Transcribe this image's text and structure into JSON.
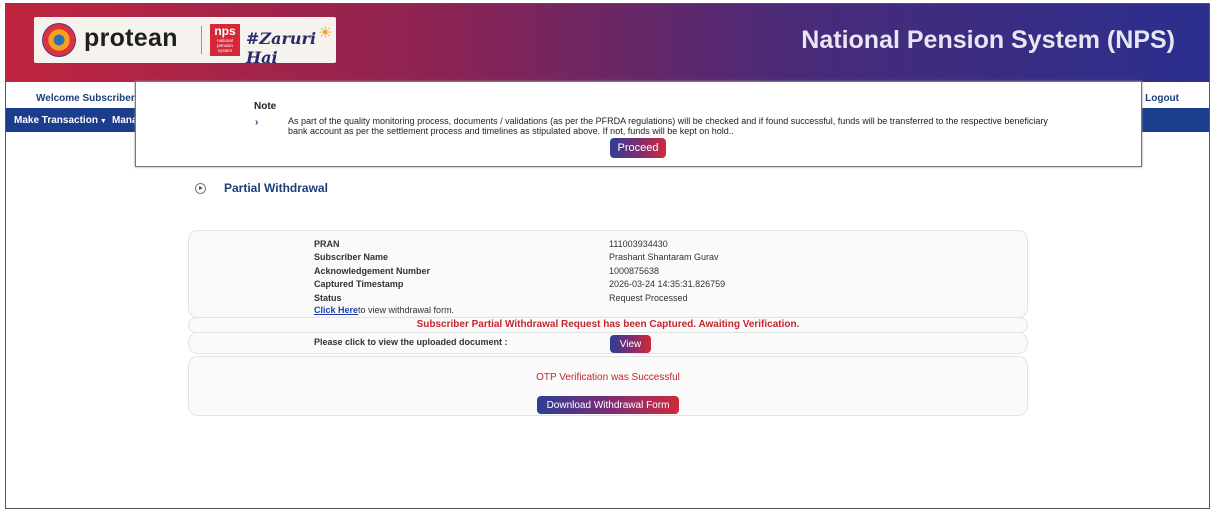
{
  "header": {
    "brand_name": "protean",
    "nps_logo_main": "nps",
    "nps_logo_sub": "national pension system",
    "tagline": "#Zaruri Hai",
    "app_title": "National Pension System (NPS)"
  },
  "welcome": {
    "text": "Welcome Subscriber-",
    "logout": "| Logout"
  },
  "nav": {
    "items": [
      "Make Transaction",
      "Mana"
    ]
  },
  "modal": {
    "title": "Note",
    "arrow": "›",
    "text": "As part of the quality monitoring process, documents / validations (as per the PFRDA regulations) will be checked and if found successful, funds will be transferred to the respective beneficiary bank account as per the settlement process and timelines as stipulated above. If not, funds will be kept on hold..",
    "proceed_label": "Proceed"
  },
  "section": {
    "title": "Partial Withdrawal"
  },
  "details": {
    "rows": [
      {
        "label": "PRAN",
        "value": "111003934430"
      },
      {
        "label": "Subscriber Name",
        "value": "Prashant Shantaram Gurav"
      },
      {
        "label": "Acknowledgement Number",
        "value": "1000875638"
      },
      {
        "label": "Captured Timestamp",
        "value": "2026-03-24 14:35:31.826759"
      },
      {
        "label": "Status",
        "value": "Request Processed"
      }
    ],
    "link_text": "Click Here",
    "link_suffix": "to view withdrawal form."
  },
  "messages": {
    "captured": "Subscriber Partial Withdrawal Request has been Captured. Awaiting Verification.",
    "upload_label": "Please click to view the uploaded document :",
    "view_label": "View",
    "otp": "OTP Verification was Successful",
    "download_label": "Download Withdrawal Form"
  }
}
